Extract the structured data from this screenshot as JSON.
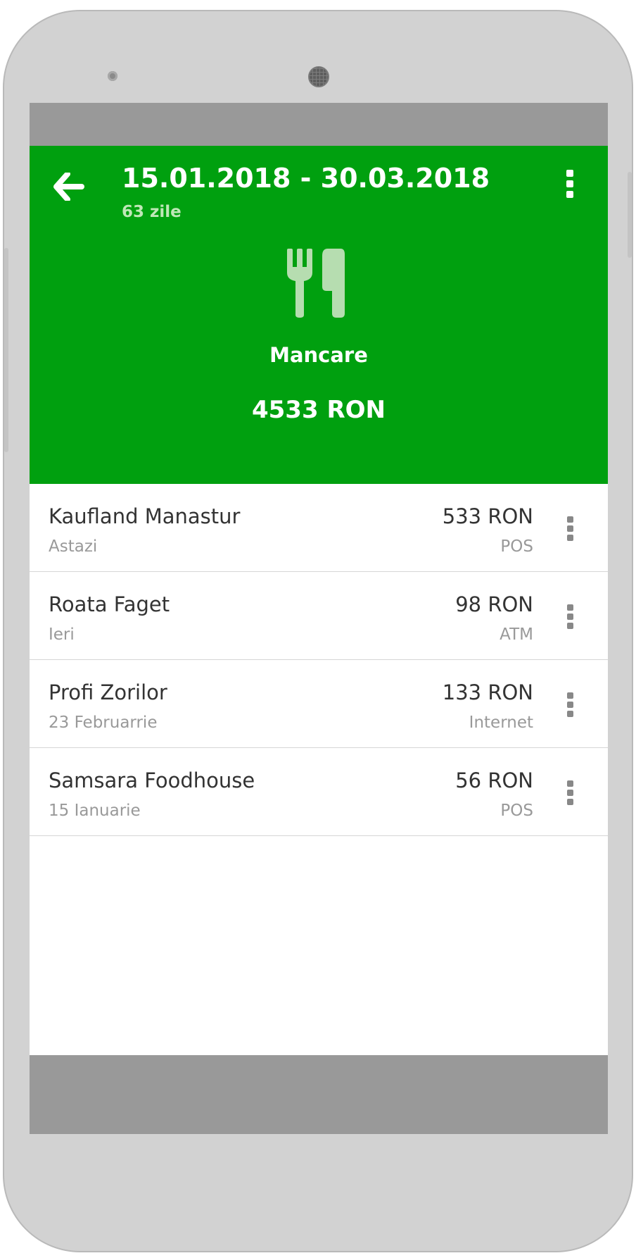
{
  "header": {
    "title": "15.01.2018 - 30.03.2018",
    "subtitle": "63 zile",
    "back_icon": "arrow-left-icon",
    "menu_icon": "more-vertical-icon",
    "background_color": "#00a00f"
  },
  "category": {
    "icon": "fork-knife-icon",
    "name": "Mancare",
    "total": "4533 RON"
  },
  "transactions": [
    {
      "name": "Kaufland Manastur",
      "date": "Astazi",
      "amount": "533 RON",
      "method": "POS"
    },
    {
      "name": "Roata Faget",
      "date": "Ieri",
      "amount": "98 RON",
      "method": "ATM"
    },
    {
      "name": "Profi Zorilor",
      "date": "23 Februarrie",
      "amount": "133 RON",
      "method": "Internet"
    },
    {
      "name": "Samsara Foodhouse",
      "date": "15 Ianuarie",
      "amount": "56 RON",
      "method": "POS"
    }
  ]
}
